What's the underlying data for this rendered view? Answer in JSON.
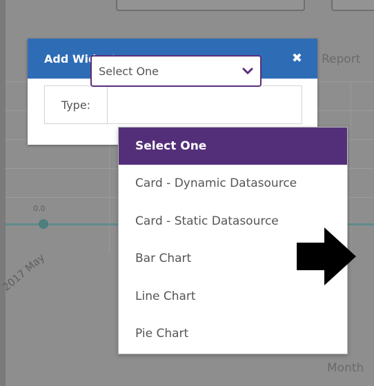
{
  "background": {
    "report_text": "Report",
    "month_text": "Month",
    "zero_label": "0.0",
    "x_tick": "2017 May"
  },
  "modal": {
    "title": "Add Widget",
    "close_icon": "close-icon",
    "type_label": "Type:",
    "select_value": "Select One"
  },
  "dropdown": {
    "options": [
      "Select One",
      "Card - Dynamic Datasource",
      "Card - Static Datasource",
      "Bar Chart",
      "Line Chart",
      "Pie Chart"
    ],
    "selected_index": 0
  },
  "colors": {
    "header": "#2e6db6",
    "selected_option": "#532f79",
    "select_border": "#5a2d7c"
  },
  "annotation": {
    "icon": "right-arrow-icon"
  }
}
